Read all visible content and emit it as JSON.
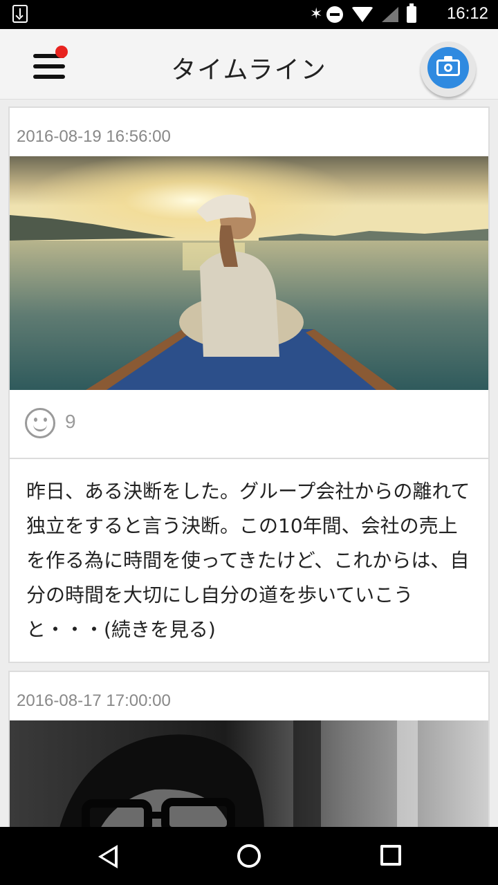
{
  "status_bar": {
    "time": "16:12"
  },
  "app_bar": {
    "title": "タイムライン",
    "menu_icon": "hamburger-menu-icon",
    "notification_dot_color": "#e8231f",
    "camera_icon": "camera-icon",
    "camera_color": "#2f8ae0"
  },
  "posts": [
    {
      "date": "2016-08-19 16:56:00",
      "photo": "woman-on-boat-sunset",
      "likes": "9",
      "text": "昨日、ある決断をした。グループ会社からの離れて独立をすると言う決断。この10年間、会社の売上を作る為に時間を使ってきたけど、これからは、自分の時間を大切にし自分の道を歩いていこうと・・・(続きを見る)"
    },
    {
      "date": "2016-08-17 17:00:00",
      "photo": "man-with-glasses-bw"
    }
  ],
  "nav_bar": {
    "back_icon": "back-triangle-icon",
    "home_icon": "home-circle-icon",
    "recent_icon": "recent-apps-square-icon"
  }
}
